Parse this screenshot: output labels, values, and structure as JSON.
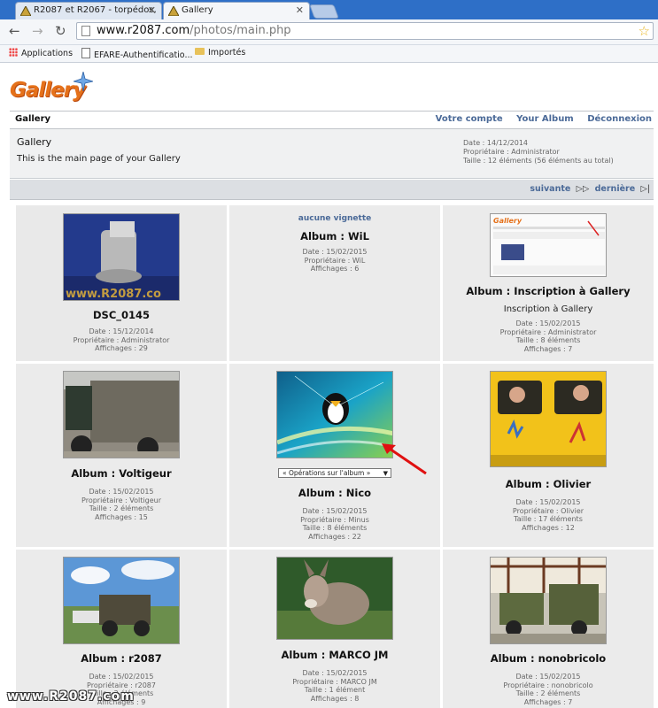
{
  "browser": {
    "tabs": [
      {
        "label": "R2087 et R2067 - torpédos,"
      },
      {
        "label": "Gallery"
      }
    ],
    "url_host": "www.r2087.com",
    "url_path": "/photos/main.php",
    "bookmarks": [
      "Applications",
      "EFARE-Authentificatio...",
      "Importés"
    ]
  },
  "header": {
    "logo_text": "Gallery",
    "title": "Gallery",
    "links": [
      "Votre compte",
      "Your Album",
      "Déconnexion"
    ]
  },
  "info": {
    "name": "Gallery",
    "description": "This is the main page of your Gallery",
    "date": "Date : 14/12/2014",
    "owner": "Propriétaire : Administrator",
    "size": "Taille : 12 éléments (56 éléments au total)"
  },
  "pager": {
    "next": "suivante",
    "last": "dernière"
  },
  "items": [
    {
      "caption": "DSC_0145",
      "lines": [
        "Date : 15/12/2014",
        "Propriétaire : Administrator",
        "Affichages : 29"
      ],
      "thumb_text": "www.R2087.co"
    },
    {
      "no_thumb": "aucune vignette",
      "caption": "Album : WiL",
      "lines": [
        "Date : 15/02/2015",
        "Propriétaire : WiL",
        "Affichages : 6"
      ]
    },
    {
      "caption": "Album : Inscription à Gallery",
      "subtitle": "Inscription à Gallery",
      "lines": [
        "Date : 15/02/2015",
        "Propriétaire : Administrator",
        "Taille : 8 éléments",
        "Affichages : 7"
      ]
    },
    {
      "caption": "Album : Voltigeur",
      "lines": [
        "Date : 15/02/2015",
        "Propriétaire : Voltigeur",
        "Taille : 2 éléments",
        "Affichages : 15"
      ]
    },
    {
      "caption": "Album : Nico",
      "dropdown": "« Opérations sur l'album »",
      "lines": [
        "Date : 15/02/2015",
        "Propriétaire : Minus",
        "Taille : 8 éléments",
        "Affichages : 22"
      ]
    },
    {
      "caption": "Album : Olivier",
      "lines": [
        "Date : 15/02/2015",
        "Propriétaire : Olivier",
        "Taille : 17 éléments",
        "Affichages : 12"
      ]
    },
    {
      "caption": "Album : r2087",
      "lines": [
        "Date : 15/02/2015",
        "Propriétaire : r2087",
        "Taille : 3 éléments",
        "Affichages : 9"
      ]
    },
    {
      "caption": "Album : MARCO JM",
      "lines": [
        "Date : 15/02/2015",
        "Propriétaire : MARCO JM",
        "Taille : 1 élément",
        "Affichages : 8"
      ]
    },
    {
      "caption": "Album : nonobricolo",
      "lines": [
        "Date : 15/02/2015",
        "Propriétaire : nonobricolo",
        "Taille : 2 éléments",
        "Affichages : 7"
      ]
    }
  ],
  "watermark": "www.R2087.com",
  "colors": {
    "link": "#4b6a98",
    "logo": "#e5711a",
    "cell_bg": "#ebebeb",
    "tabstrip": "#2e6fc7"
  }
}
